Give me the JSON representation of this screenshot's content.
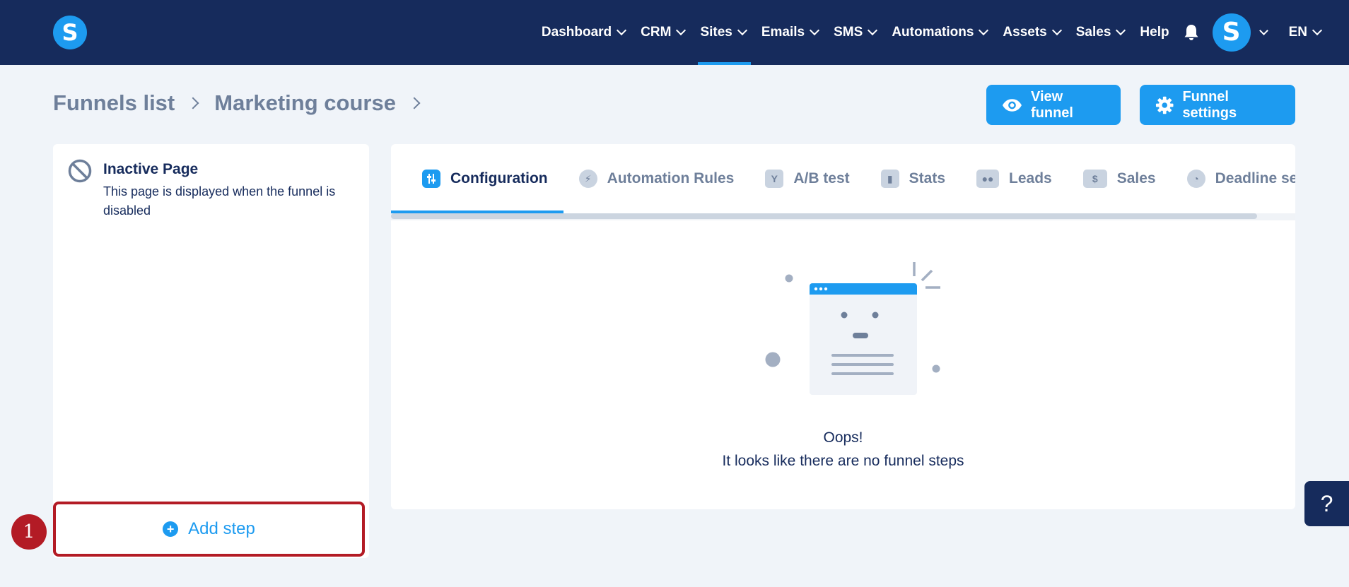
{
  "app": {
    "logo_letter": "S"
  },
  "nav": {
    "items": [
      {
        "label": "Dashboard",
        "has_dropdown": true
      },
      {
        "label": "CRM",
        "has_dropdown": true
      },
      {
        "label": "Sites",
        "has_dropdown": true,
        "active": true
      },
      {
        "label": "Emails",
        "has_dropdown": true
      },
      {
        "label": "SMS",
        "has_dropdown": true
      },
      {
        "label": "Automations",
        "has_dropdown": true
      },
      {
        "label": "Assets",
        "has_dropdown": true
      },
      {
        "label": "Sales",
        "has_dropdown": true
      },
      {
        "label": "Help",
        "has_dropdown": false
      }
    ],
    "avatar_letter": "S",
    "language": "EN"
  },
  "breadcrumb": {
    "root": "Funnels list",
    "current": "Marketing course"
  },
  "actions": {
    "view_funnel": "View funnel",
    "funnel_settings": "Funnel settings"
  },
  "left_panel": {
    "inactive_title": "Inactive Page",
    "inactive_desc": "This page is displayed when the funnel is disabled",
    "add_step": "Add step",
    "step_badge": "1"
  },
  "tabs": [
    {
      "label": "Configuration",
      "icon": "sliders-icon",
      "active": true
    },
    {
      "label": "Automation Rules",
      "icon": "bolt-icon"
    },
    {
      "label": "A/B test",
      "icon": "split-icon"
    },
    {
      "label": "Stats",
      "icon": "bar-chart-icon"
    },
    {
      "label": "Leads",
      "icon": "users-icon"
    },
    {
      "label": "Sales",
      "icon": "dollar-icon"
    },
    {
      "label": "Deadline setti",
      "icon": "clock-icon"
    }
  ],
  "empty_state": {
    "line1": "Oops!",
    "line2": "It looks like there are no funnel steps"
  },
  "help_float": "?",
  "colors": {
    "navy": "#162b5c",
    "accent": "#1d9bf0",
    "highlight": "#b31b25",
    "muted": "#6e7f9a"
  }
}
